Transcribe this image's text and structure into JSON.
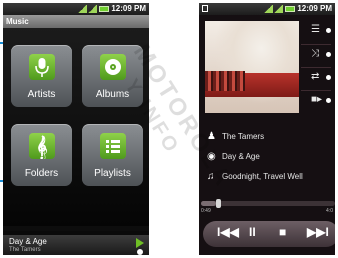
{
  "left": {
    "status_time": "12:09 PM",
    "app_title": "Music",
    "tiles": [
      {
        "label": "Artists",
        "icon": "microphone-icon"
      },
      {
        "label": "Albums",
        "icon": "disc-icon"
      },
      {
        "label": "Folders",
        "icon": "treble-clef-icon"
      },
      {
        "label": "Playlists",
        "icon": "list-icon"
      }
    ],
    "now_playing": {
      "title": "Day & Age",
      "artist": "The Tamers"
    }
  },
  "right": {
    "status_time": "12:09 PM",
    "side_controls": [
      "playlist-icon",
      "shuffle-icon",
      "repeat-icon",
      "volume-icon"
    ],
    "info": {
      "artist": "The Tamers",
      "album": "Day & Age",
      "track": "Goodnight, Travel Well"
    },
    "progress": {
      "elapsed": "0:49",
      "total": "4:0",
      "fraction": 0.11
    },
    "transport": [
      "previous-icon",
      "pause-icon",
      "stop-icon",
      "next-icon"
    ]
  },
  "colors": {
    "accent_green": "#6fbf25",
    "callout_blue": "#1a8fd8"
  },
  "watermark": {
    "line1": "MOTOROLA",
    "line2": "Y INFO"
  }
}
